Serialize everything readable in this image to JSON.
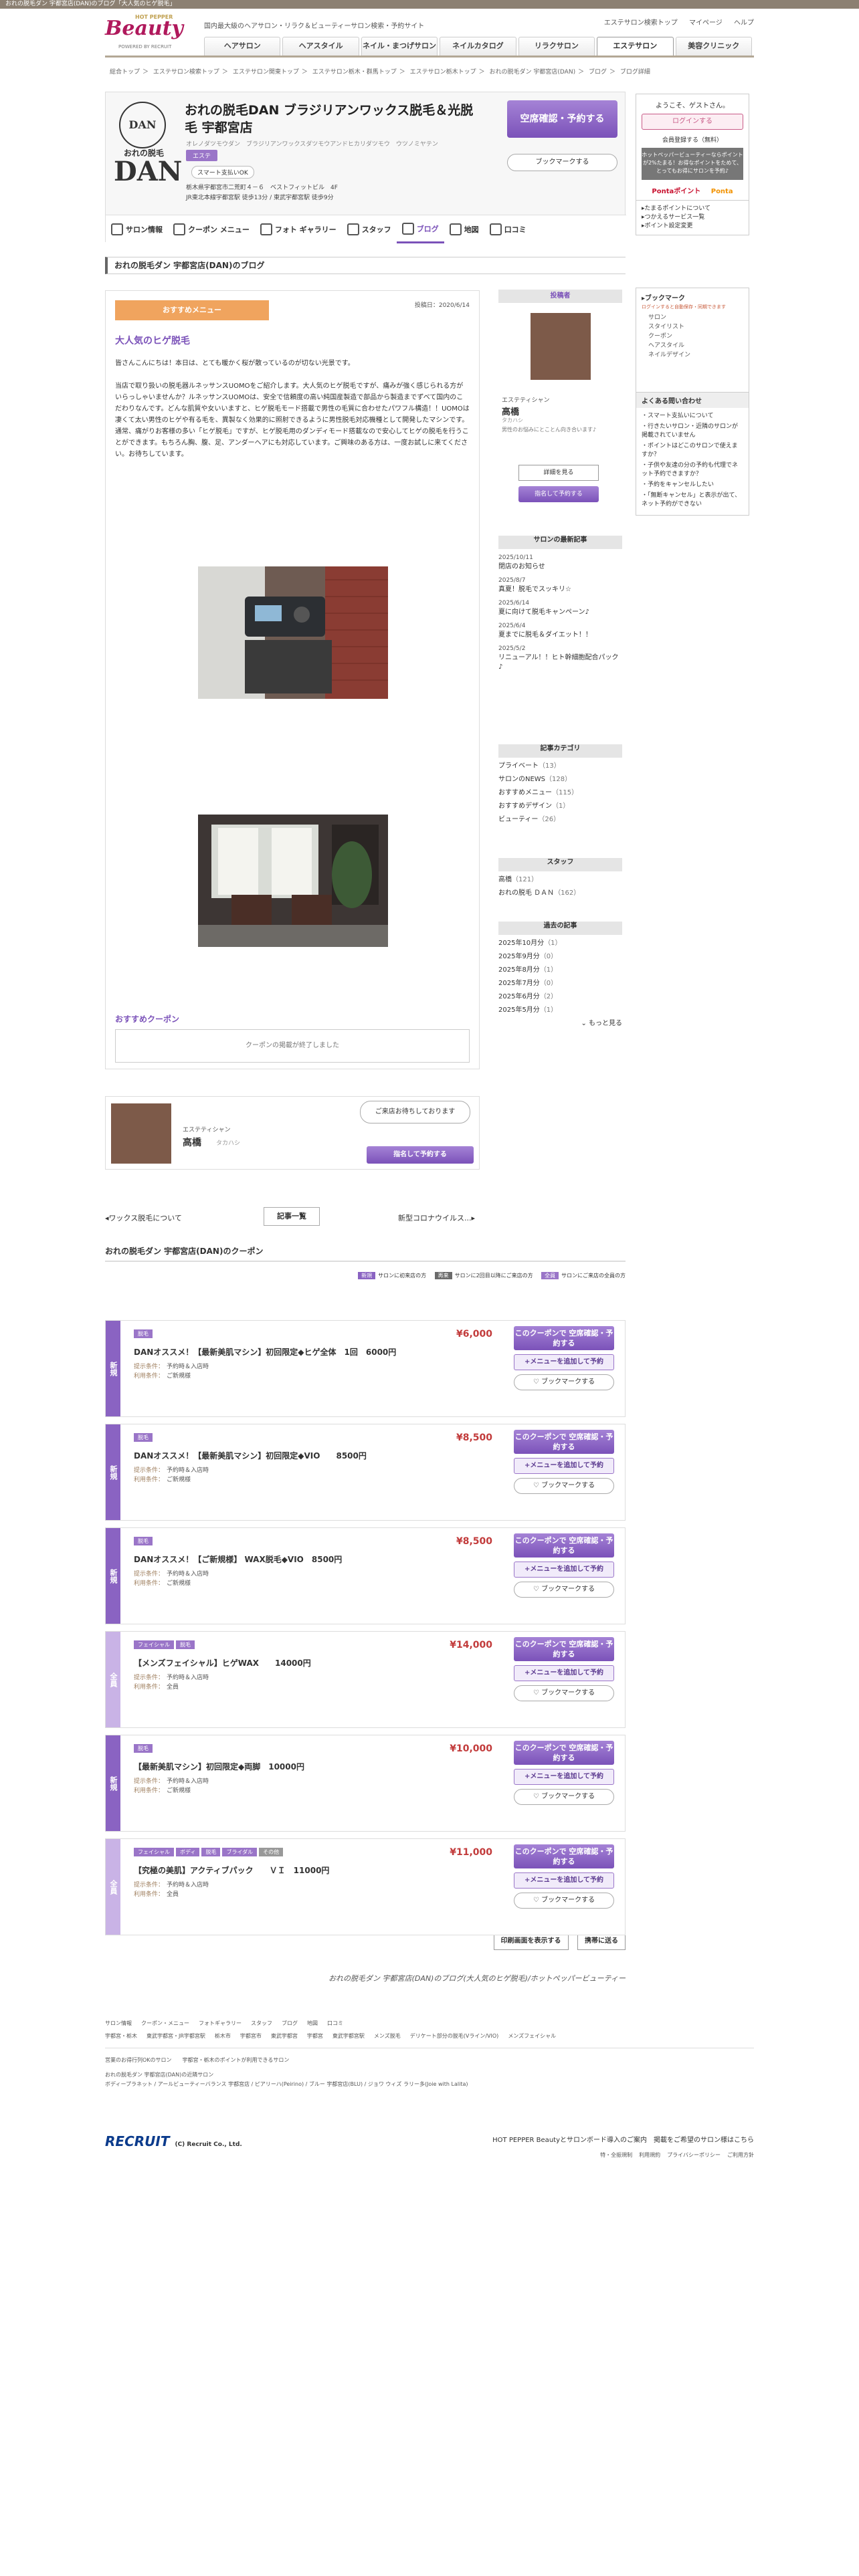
{
  "top_strip": "おれの脱毛ダン 宇都宮店(DAN)のブログ「大人気のヒゲ脱毛」",
  "header": {
    "hotpepper": "HOT PEPPER",
    "beauty": "Beauty",
    "powered": "POWERED BY RECRUIT",
    "tagline": "国内最大級のヘアサロン・リラク＆ビューティーサロン検索・予約サイト",
    "links": [
      "エステサロン検索トップ",
      "マイページ",
      "ヘルプ"
    ]
  },
  "gnav": [
    "ヘアサロン",
    "ヘアスタイル",
    "ネイル・まつげサロン",
    "ネイルカタログ",
    "リラクサロン",
    "エステサロン",
    "美容クリニック"
  ],
  "breadcrumb": [
    "総合トップ",
    "エステサロン検索トップ",
    "エステサロン関東トップ",
    "エステサロン栃木・群馬トップ",
    "エステサロン栃木トップ",
    "おれの脱毛ダン 宇都宮店(DAN)",
    "ブログ",
    "ブログ詳細"
  ],
  "salon": {
    "logo_top": "DAN",
    "logo_jp": "おれの脱毛",
    "logo_big": "DAN",
    "name": "おれの脱毛DAN ブラジリアンワックス脱毛＆光脱毛 宇都宮店",
    "kana": "オレノダツモウダン　ブラジリアンワックスダツモウアンドヒカリダツモウ　ウツノミヤテン",
    "category": "エステ",
    "payment": "スマート支払いOK",
    "address1": "栃木県宇都宮市二荒町４－６　ベストフィットビル　4F",
    "address2": "JR東北本線宇都宮駅 徒歩13分 / 東武宇都宮駅 徒歩9分",
    "reserve": "空席確認・予約する",
    "bookmark": "ブックマークする"
  },
  "salon_tabs": [
    "サロン情報",
    "クーポン メニュー",
    "フォト ギャラリー",
    "スタッフ",
    "ブログ",
    "地図",
    "口コミ"
  ],
  "blog_header": "おれの脱毛ダン 宇都宮店(DAN)のブログ",
  "article": {
    "recommend": "おすすめメニュー",
    "date": "投稿日：2020/6/14",
    "title": "大人気のヒゲ脱毛",
    "body": [
      "皆さんこんにちは！本日は、とても暖かく桜が散っているのが切ない光景です。",
      "当店で取り扱いの脱毛器ルネッサンスUOMOをご紹介します。大人気のヒゲ脱毛ですが、痛みが強く感じられる方がいらっしゃいませんか？ルネッサンスUOMOは、安全で信頼度の高い純国産製造で部品から製造までずべて国内のこだわりなんです。どんな肌質や女いいますと、ヒゲ脱毛モード搭載で男性の毛質に合わせたパワフル構造！！UOMOは凄くて太い男性のヒゲや有る毛を、異製なく効果的に照射できるように男性脱毛対応機種として開発したマシンです。",
      "通常、痛がりお客様の多い「ヒゲ脱毛」ですが、ヒゲ脱毛用のダンディモード搭載なので安心してヒゲの脱毛を行うことができます。もちろん胸、腹、足、アンダーへアにも対応しています。ご興味のある方は、一度お試しに来てください。お待ちしています。"
    ],
    "coupon_title": "おすすめクーポン",
    "coupon_empty": "クーポンの掲載が終了しました"
  },
  "staff": {
    "role": "エステティシャン",
    "name": "高橋",
    "kana": "タカハシ",
    "bubble": "ご来店お待ちしております",
    "reserve": "指名して予約する"
  },
  "pager": {
    "prev": "ワックス脱毛について",
    "list": "記事一覧",
    "next": "新型コロナウイルス..."
  },
  "coupons_title": "おれの脱毛ダン 宇都宮店(DAN)のクーポン",
  "legend": [
    {
      "tag": "新規",
      "text": "サロンに初来店の方"
    },
    {
      "tag": "再来",
      "text": "サロンに2回目以降にご来店の方"
    },
    {
      "tag": "全員",
      "text": "サロンにご来店の全員の方"
    }
  ],
  "coupons": [
    {
      "band": "新規",
      "tags": [
        "脱毛"
      ],
      "price": "¥6,000",
      "name": "DANオススメ！【最新美肌マシン】初回限定◆ヒゲ全体　1回　6000円",
      "cond1": "予約時＆入店時",
      "cond2": "ご新規様"
    },
    {
      "band": "新規",
      "tags": [
        "脱毛"
      ],
      "price": "¥8,500",
      "name": "DANオススメ！【最新美肌マシン】初回限定◆VIO　　8500円",
      "cond1": "予約時＆入店時",
      "cond2": "ご新規様"
    },
    {
      "band": "新規",
      "tags": [
        "脱毛"
      ],
      "price": "¥8,500",
      "name": "DANオススメ！【ご新規様】 WAX脱毛◆VIO　8500円",
      "cond1": "予約時＆入店時",
      "cond2": "ご新規様"
    },
    {
      "band": "全員",
      "tags": [
        "フェイシャル",
        "脱毛"
      ],
      "price": "¥14,000",
      "name": "【メンズフェイシャル】ヒゲWAX　　14000円",
      "cond1": "予約時＆入店時",
      "cond2": "全員"
    },
    {
      "band": "新規",
      "tags": [
        "脱毛"
      ],
      "price": "¥10,000",
      "name": "【最新美肌マシン】初回限定◆両脚　10000円",
      "cond1": "予約時＆入店時",
      "cond2": "ご新規様"
    },
    {
      "band": "全員",
      "tags": [
        "フェイシャル",
        "ボディ",
        "脱毛",
        "ブライダル",
        "その他"
      ],
      "price": "¥11,000",
      "name": "【究極の美肌】アクティブパック　　ＶＩ　11000円",
      "cond1": "予約時＆入店時",
      "cond2": "全員"
    }
  ],
  "coupon_labels": {
    "cond1": "提示条件：",
    "cond2": "利用条件：",
    "reserve": "このクーポンで 空席確認・予約する",
    "add": "+メニューを追加して予約",
    "bookmark": "ブックマークする"
  },
  "print": [
    "印刷画面を表示する",
    "携帯に送る"
  ],
  "footnote": "おれの脱毛ダン 宇都宮店(DAN)のブログ(大人気のヒゲ脱毛)/ホットペッパービューティー",
  "sidebar": {
    "poster_h": "投稿者",
    "poster_role": "エステティシャン",
    "poster_name": "高橋",
    "poster_kana": "タカハシ",
    "poster_desc": "男性のお悩みにとことん向き合います♪",
    "poster_b1": "詳細を見る",
    "poster_b2": "指名して予約する",
    "latest_h": "サロンの最新記事",
    "latest": [
      {
        "d": "2025/10/11",
        "t": "閉店のお知らせ"
      },
      {
        "d": "2025/8/7",
        "t": "真夏！脱毛でスッキリ☆"
      },
      {
        "d": "2025/6/14",
        "t": "夏に向けて脱毛キャンペーン♪"
      },
      {
        "d": "2025/6/4",
        "t": "夏までに脱毛＆ダイエット！！"
      },
      {
        "d": "2025/5/2",
        "t": "リニューアル！！ヒト幹細胞配合パック♪"
      }
    ],
    "cat_h": "記事カテゴリ",
    "cats": [
      {
        "n": "プライベート",
        "c": "（13）"
      },
      {
        "n": "サロンのNEWS",
        "c": "（128）"
      },
      {
        "n": "おすすめメニュー",
        "c": "（115）"
      },
      {
        "n": "おすすめデザイン",
        "c": "（1）"
      },
      {
        "n": "ビューティー",
        "c": "（26）"
      }
    ],
    "staff_h": "スタッフ",
    "staffs": [
      {
        "n": "高橋",
        "c": "（121）"
      },
      {
        "n": "おれの脱毛 ＤＡＮ",
        "c": "（162）"
      }
    ],
    "past_h": "過去の記事",
    "past": [
      {
        "n": "2025年10月分",
        "c": "（1）"
      },
      {
        "n": "2025年9月分",
        "c": "（0）"
      },
      {
        "n": "2025年8月分",
        "c": "（1）"
      },
      {
        "n": "2025年7月分",
        "c": "（0）"
      },
      {
        "n": "2025年6月分",
        "c": "（2）"
      },
      {
        "n": "2025年5月分",
        "c": "（1）"
      }
    ],
    "more": "もっと見る"
  },
  "right": {
    "greeting": "ようこそ、ゲストさん。",
    "login": "ログインする",
    "register": "会員登録する（無料）",
    "point_promo": "ホットペッパービューティーならポイントが2%たまる！お得なポイントをためて、とってもお得にサロンを予約♪",
    "logos": [
      "Pontaポイント",
      "Ponta"
    ],
    "links": [
      "たまるポイントについて",
      "つかえるサービス一覧",
      "ポイント設定変更"
    ],
    "bm_h": "ブックマーク",
    "bm_note": "ログインすると自動保存・同期できます",
    "bm_items": [
      "サロン",
      "スタイリスト",
      "クーポン",
      "ヘアスタイル",
      "ネイルデザイン"
    ],
    "faq_h": "よくある問い合わせ",
    "faq": [
      "スマート支払いについて",
      "行きたいサロン・近隣のサロンが掲載されていません",
      "ポイントはどこのサロンで使えますか？",
      "子供や友達の分の予約も代理でネット予約できますか？",
      "予約をキャンセルしたい",
      "「無断キャンセル」と表示が出て、ネット予約ができない"
    ]
  },
  "footer": {
    "row1": [
      "サロン情報",
      "クーポン・メニュー",
      "フォトギャラリー",
      "スタッフ",
      "ブログ",
      "地図",
      "口コミ"
    ],
    "row2": [
      "宇都宮・栃木",
      "東武宇都宮・JR宇都宮駅",
      "栃木市",
      "宇都宮市",
      "東武宇都宮",
      "宇都宮",
      "東武宇都宮駅",
      "メンズ脱毛",
      "デリケート部分の脱毛(Vライン/VIO)",
      "メンズフェイシャル"
    ],
    "row3": "営業のお得行列OKのサロン　　宇都宮・栃木のポイントが利用できるサロン",
    "row4a": "おれの脱毛ダン 宇都宮店(DAN)の近隣サロン",
    "row4b": "ボディープラネット / アールビューティーバランス 宇都宮店 / ピアリーハ(Peirino) / ブルー 宇都宮店(BLU) / ジョワ ウィズ ラリー多(Joie with Lalita)",
    "recruit": "RECRUIT",
    "copy": "(C) Recruit Co., Ltd.",
    "link_main": "HOT PEPPER Beautyとサロンボード導入のご案内　掲載をご希望のサロン様はこちら",
    "links2": [
      "特・全振規制",
      "利用規約",
      "プライバシーポリシー",
      "ご利用方針"
    ]
  },
  "colors": {
    "purple": "#7b52b9",
    "pink": "#b0195c",
    "band_new": "#8a63c2",
    "band_all": "#c9b3e6"
  }
}
